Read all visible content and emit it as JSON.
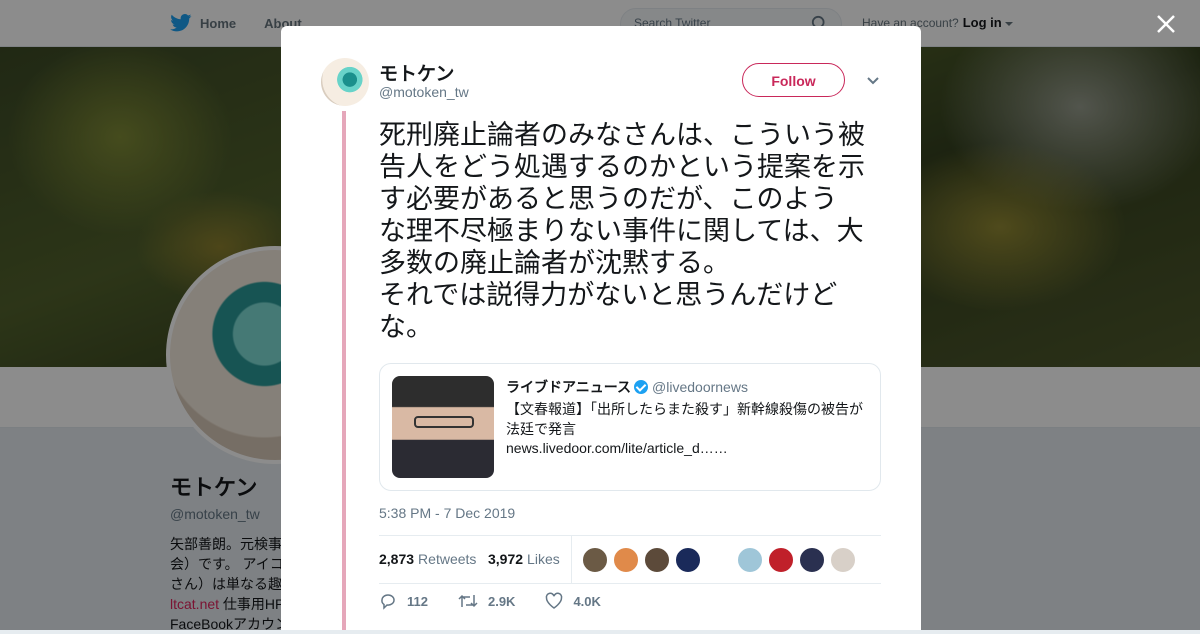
{
  "nav": {
    "home_label": "Home",
    "about_label": "About",
    "search_placeholder": "Search Twitter",
    "account_prompt": "Have an account?",
    "login_label": "Log in"
  },
  "profile": {
    "name": "モトケン",
    "handle": "@motoken_tw",
    "bio_line1": "矢部善朗。元検事",
    "bio_line2": "会）です。 アイコ",
    "bio_line3": "さん）は単なる趣",
    "bio_link": "ltcat.net",
    "bio_link_suffix": " 仕事用HP",
    "bio_line5": "FaceBookアカウン"
  },
  "tweet": {
    "author_name": "モトケン",
    "author_handle": "@motoken_tw",
    "follow_label": "Follow",
    "text_lines": [
      "死刑廃止論者のみなさんは、こういう被",
      "告人をどう処遇するのかという提案を示",
      "す必要があると思うのだが、このよう",
      "な理不尽極まりない事件に関しては、大",
      "多数の廃止論者が沈黙する。",
      "それでは説得力がないと思うんだけど",
      "な。"
    ],
    "quoted": {
      "name": "ライブドアニュース",
      "handle": "@livedoornews",
      "text": "【文春報道】「出所したらまた殺す」新幹線殺傷の被告が法廷で発言",
      "url": "news.livedoor.com/lite/article_d……"
    },
    "timestamp": "5:38 PM - 7 Dec 2019",
    "retweets_count": "2,873",
    "retweets_label": "Retweets",
    "likes_count": "3,972",
    "likes_label": "Likes",
    "reply_count": "112",
    "retweet_count_short": "2.9K",
    "like_count_short": "4.0K"
  },
  "colors": {
    "accent": "#c9285a",
    "thread": "#e5a7ba",
    "twitter_blue": "#1da1f2",
    "likers": [
      "#6b5a45",
      "#e08a4a",
      "#5c4a3a",
      "#1a2a5a",
      "#ffffff",
      "#9fc6d8",
      "#c0202a",
      "#2a3050",
      "#d8d0c8"
    ]
  }
}
